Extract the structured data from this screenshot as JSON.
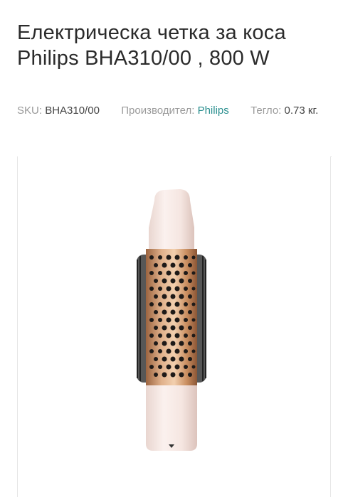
{
  "product": {
    "title": "Електрическа четка за коса Philips BHA310/00 , 800 W",
    "sku_label": "SKU:",
    "sku_value": "BHA310/00",
    "manufacturer_label": "Производител:",
    "manufacturer_value": "Philips",
    "weight_label": "Тегло:",
    "weight_value": "0.73 кг."
  },
  "image": {
    "name": "hair-brush-product-image"
  },
  "colors": {
    "title": "#2b2b2b",
    "link": "#2a8f8f",
    "body_pink": "#f3e6e1",
    "bronze": "#c98d5f"
  }
}
